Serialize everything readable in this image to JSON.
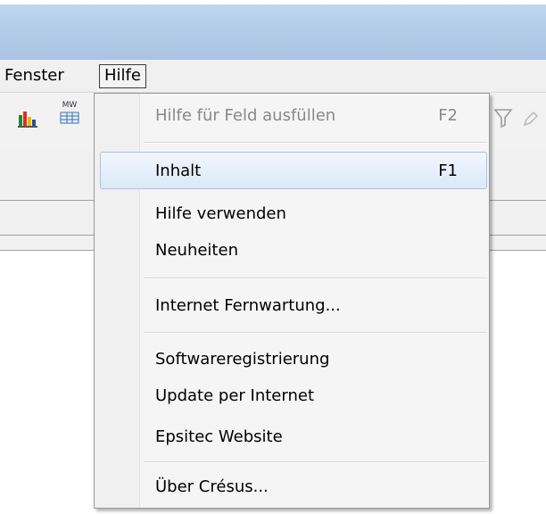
{
  "menubar": {
    "items": [
      {
        "label": "Fenster"
      },
      {
        "label": "Hilfe"
      }
    ]
  },
  "toolbar": {
    "icons": [
      "bar-chart-icon",
      "mw-currency-table-icon",
      "filter-icon"
    ],
    "mw_label": "MW"
  },
  "help_menu": {
    "items": [
      {
        "label": "Hilfe für Feld ausfüllen",
        "shortcut": "F2",
        "enabled": false
      },
      {
        "label": "Inhalt",
        "shortcut": "F1",
        "highlighted": true
      },
      {
        "label": "Hilfe verwenden"
      },
      {
        "label": "Neuheiten"
      },
      {
        "label": "Internet Fernwartung..."
      },
      {
        "label": "Softwareregistrierung"
      },
      {
        "label": "Update per Internet"
      },
      {
        "label": "Epsitec Website"
      },
      {
        "label": "Über Crésus..."
      }
    ]
  },
  "colors": {
    "titlebar": "#b3cce8",
    "menu_background": "#f5f5f5",
    "highlight": "#dce9f9",
    "highlight_border": "#a7c2e4",
    "disabled_text": "#888888"
  }
}
